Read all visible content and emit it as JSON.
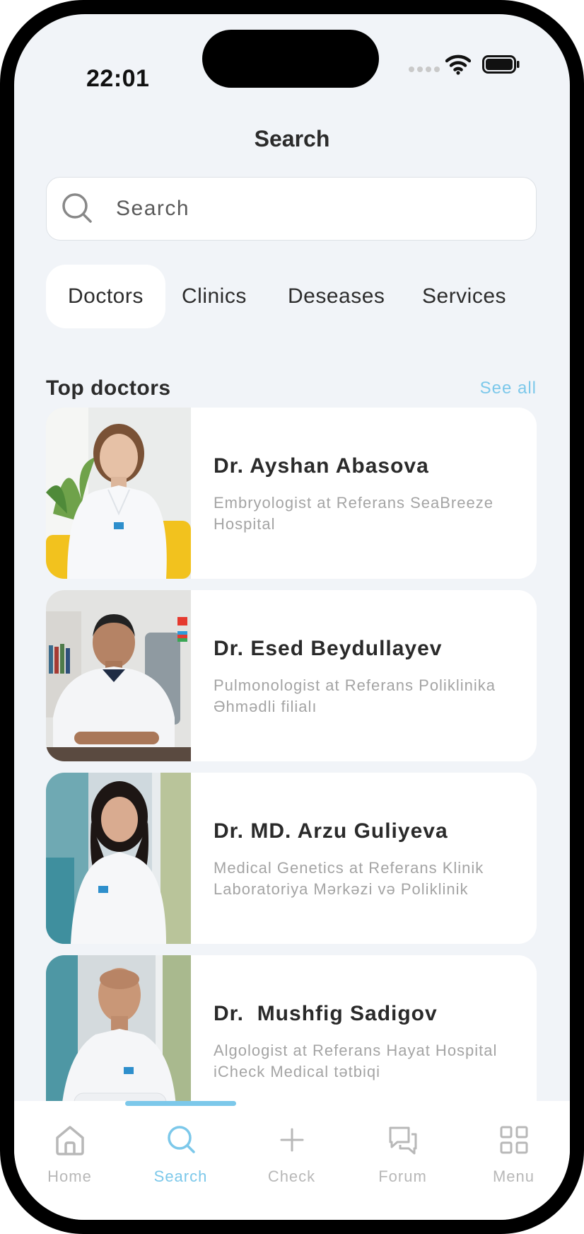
{
  "status_bar": {
    "time": "22:01"
  },
  "header": {
    "title": "Search"
  },
  "search": {
    "placeholder": "Search"
  },
  "tabs": [
    {
      "label": "Doctors",
      "active": true
    },
    {
      "label": "Clinics",
      "active": false
    },
    {
      "label": "Deseases",
      "active": false
    },
    {
      "label": "Services",
      "active": false
    }
  ],
  "top_doctors": {
    "title": "Top doctors",
    "see_all": "See all",
    "items": [
      {
        "name": "Dr. Ayshan Abasova",
        "description": "Embryologist at Referans SeaBreeze Hospital"
      },
      {
        "name": "Dr. Esed Beydullayev",
        "description": "Pulmonologist at Referans Poliklinika Əhmədli filialı"
      },
      {
        "name": "Dr. MD. Arzu Guliyeva",
        "description": "Medical Genetics at Referans Klinik Laboratoriya Mərkəzi və Poliklinik"
      },
      {
        "name": "Dr.  Mushfig Sadigov",
        "description": "Algologist at Referans Hayat Hospital iCheck Medical tətbiqi"
      }
    ]
  },
  "tabbar": {
    "items": [
      {
        "label": "Home",
        "icon": "home-icon",
        "active": false
      },
      {
        "label": "Search",
        "icon": "search-icon",
        "active": true
      },
      {
        "label": "Check",
        "icon": "plus-icon",
        "active": false
      },
      {
        "label": "Forum",
        "icon": "chat-bubbles-icon",
        "active": false
      },
      {
        "label": "Menu",
        "icon": "grid-icon",
        "active": false
      }
    ]
  },
  "colors": {
    "accent": "#7cc8ea",
    "background": "#f1f4f8",
    "card": "#ffffff",
    "text": "#2b2b2b",
    "muted": "#a4a4a4",
    "nav_inactive": "#b8b8b8"
  }
}
